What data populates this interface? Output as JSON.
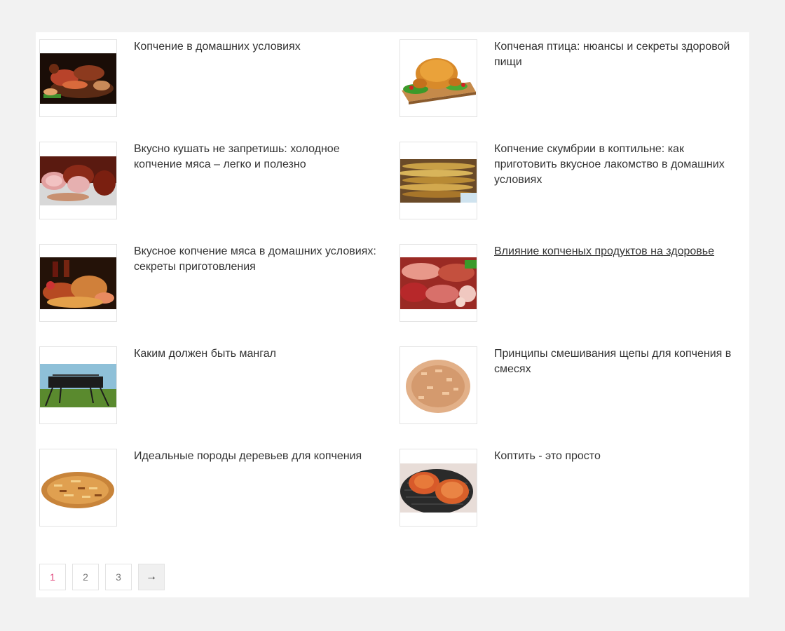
{
  "articles": [
    {
      "title": "Копчение в домашних условиях",
      "image": "smoked-meats-platter-image"
    },
    {
      "title": "Копченая птица: нюансы и секреты здоровой пищи",
      "image": "smoked-chicken-image"
    },
    {
      "title": "Вкусно кушать не запретишь: холодное копчение мяса – легко и полезно",
      "image": "cold-smoked-meat-image"
    },
    {
      "title": "Копчение скумбрии в коптильне: как приготовить вкусное лакомство в домашних условиях",
      "image": "smoked-mackerel-image"
    },
    {
      "title": "Вкусное копчение мяса в домашних условиях: секреты приготовления",
      "image": "smoked-meat-wine-image"
    },
    {
      "title": "Влияние копченых продуктов на здоровье",
      "image": "sausages-image"
    },
    {
      "title": "Каким должен быть мангал",
      "image": "grill-image"
    },
    {
      "title": "Принципы смешивания щепы для копчения в смесях",
      "image": "wood-chips-pile-image"
    },
    {
      "title": "Идеальные породы деревьев для копчения",
      "image": "wood-chips-image"
    },
    {
      "title": "Коптить - это просто",
      "image": "grilled-chicken-image"
    }
  ],
  "pagination": {
    "pages": [
      "1",
      "2",
      "3"
    ],
    "current": "1",
    "next_label": "→"
  }
}
